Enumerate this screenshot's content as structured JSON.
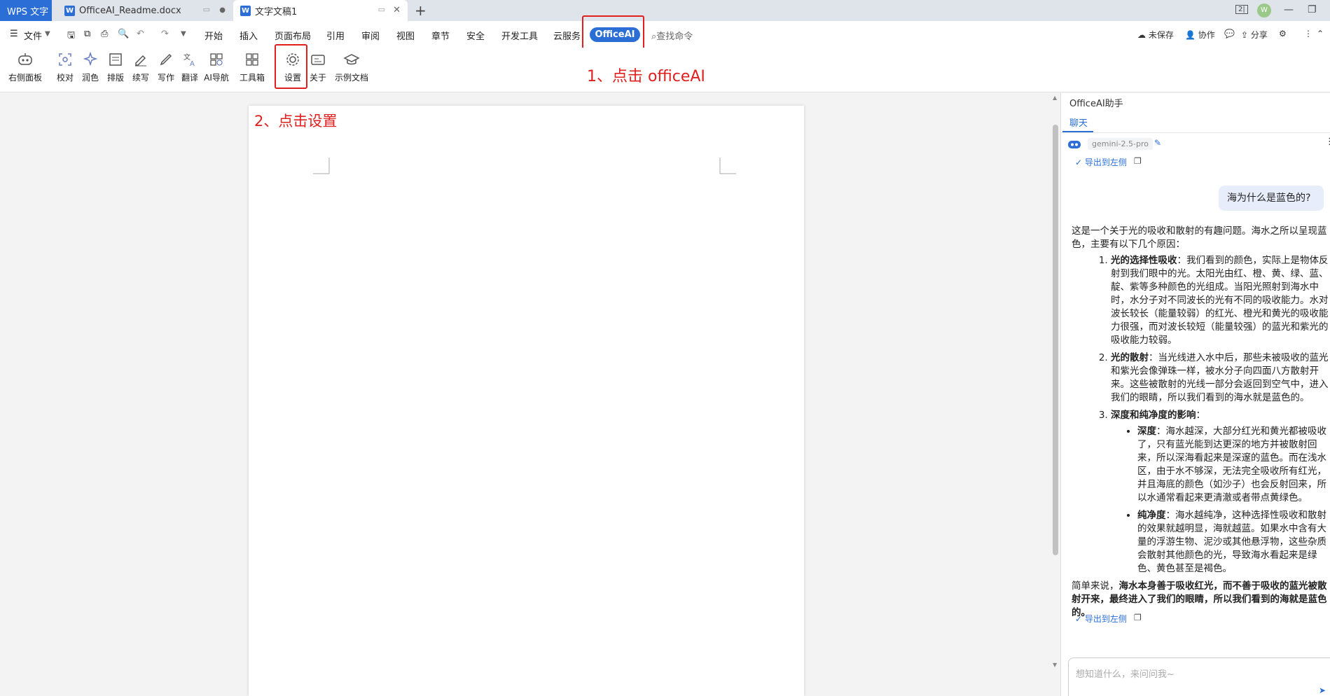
{
  "titlebar": {
    "tabs": [
      {
        "label": "WPS 文字"
      },
      {
        "label": "OfficeAI_Readme.docx"
      },
      {
        "label": "文字文稿1"
      }
    ],
    "new_tab": "+",
    "avatar": "W"
  },
  "menubar": {
    "file": "文件",
    "items": [
      "开始",
      "插入",
      "页面布局",
      "引用",
      "审阅",
      "视图",
      "章节",
      "安全",
      "开发工具",
      "云服务"
    ],
    "officeai": "OfficeAI",
    "search": "查找命令",
    "unsaved": "未保存",
    "collab": "协作",
    "share": "分享"
  },
  "ribbon": {
    "buttons": [
      {
        "label": "右侧面板",
        "icon": "robot-icon"
      },
      {
        "label": "校对",
        "icon": "proofread-icon"
      },
      {
        "label": "润色",
        "icon": "sparkle-icon"
      },
      {
        "label": "排版",
        "icon": "layout-icon"
      },
      {
        "label": "续写",
        "icon": "continue-write-icon"
      },
      {
        "label": "写作",
        "icon": "pen-icon"
      },
      {
        "label": "翻译",
        "icon": "translate-icon"
      },
      {
        "label": "AI导航",
        "icon": "ai-nav-icon"
      },
      {
        "label": "工具箱",
        "icon": "toolbox-icon"
      },
      {
        "label": "设置",
        "icon": "gear-icon"
      },
      {
        "label": "关于",
        "icon": "about-icon"
      },
      {
        "label": "示例文档",
        "icon": "graduation-icon"
      }
    ]
  },
  "annotations": {
    "step1": "1、点击 officeAI",
    "step2": "2、点击设置"
  },
  "pane": {
    "title": "OfficeAI助手",
    "tab": "聊天",
    "model": "gemini-2.5-pro",
    "export_label": "导出到左侧",
    "question": "海为什么是蓝色的?",
    "intro": "这是一个关于光的吸收和散射的有趣问题。海水之所以呈现蓝色，主要有以下几个原因：",
    "points": [
      {
        "title": "光的选择性吸收",
        "text": "：我们看到的颜色，实际上是物体反射到我们眼中的光。太阳光由红、橙、黄、绿、蓝、靛、紫等多种颜色的光组成。当阳光照射到海水中时，水分子对不同波长的光有不同的吸收能力。水对波长较长（能量较弱）的红光、橙光和黄光的吸收能力很强，而对波长较短（能量较强）的蓝光和紫光的吸收能力较弱。"
      },
      {
        "title": "光的散射",
        "text": "：当光线进入水中后，那些未被吸收的蓝光和紫光会像弹珠一样，被水分子向四面八方散射开来。这些被散射的光线一部分会返回到空气中，进入我们的眼睛，所以我们看到的海水就是蓝色的。"
      },
      {
        "title": "深度和纯净度的影响",
        "text": "："
      }
    ],
    "subpoints": [
      {
        "title": "深度",
        "text": "：海水越深，大部分红光和黄光都被吸收了，只有蓝光能到达更深的地方并被散射回来，所以深海看起来是深邃的蓝色。而在浅水区，由于水不够深，无法完全吸收所有红光，并且海底的颜色（如沙子）也会反射回来，所以水通常看起来更清澈或者带点黄绿色。"
      },
      {
        "title": "纯净度",
        "text": "：海水越纯净，这种选择性吸收和散射的效果就越明显，海就越蓝。如果水中含有大量的浮游生物、泥沙或其他悬浮物，这些杂质会散射其他颜色的光，导致海水看起来是绿色、黄色甚至是褐色。"
      }
    ],
    "summary_lead": "简单来说，",
    "summary_bold": "海水本身善于吸收红光，而不善于吸收的蓝光被散射开来，最终进入了我们的眼睛，所以我们看到的海就是蓝色的。",
    "input_placeholder": "想知道什么，来问问我~"
  },
  "colors": {
    "accent": "#2b6fd6",
    "annotation_red": "#e0201f"
  }
}
